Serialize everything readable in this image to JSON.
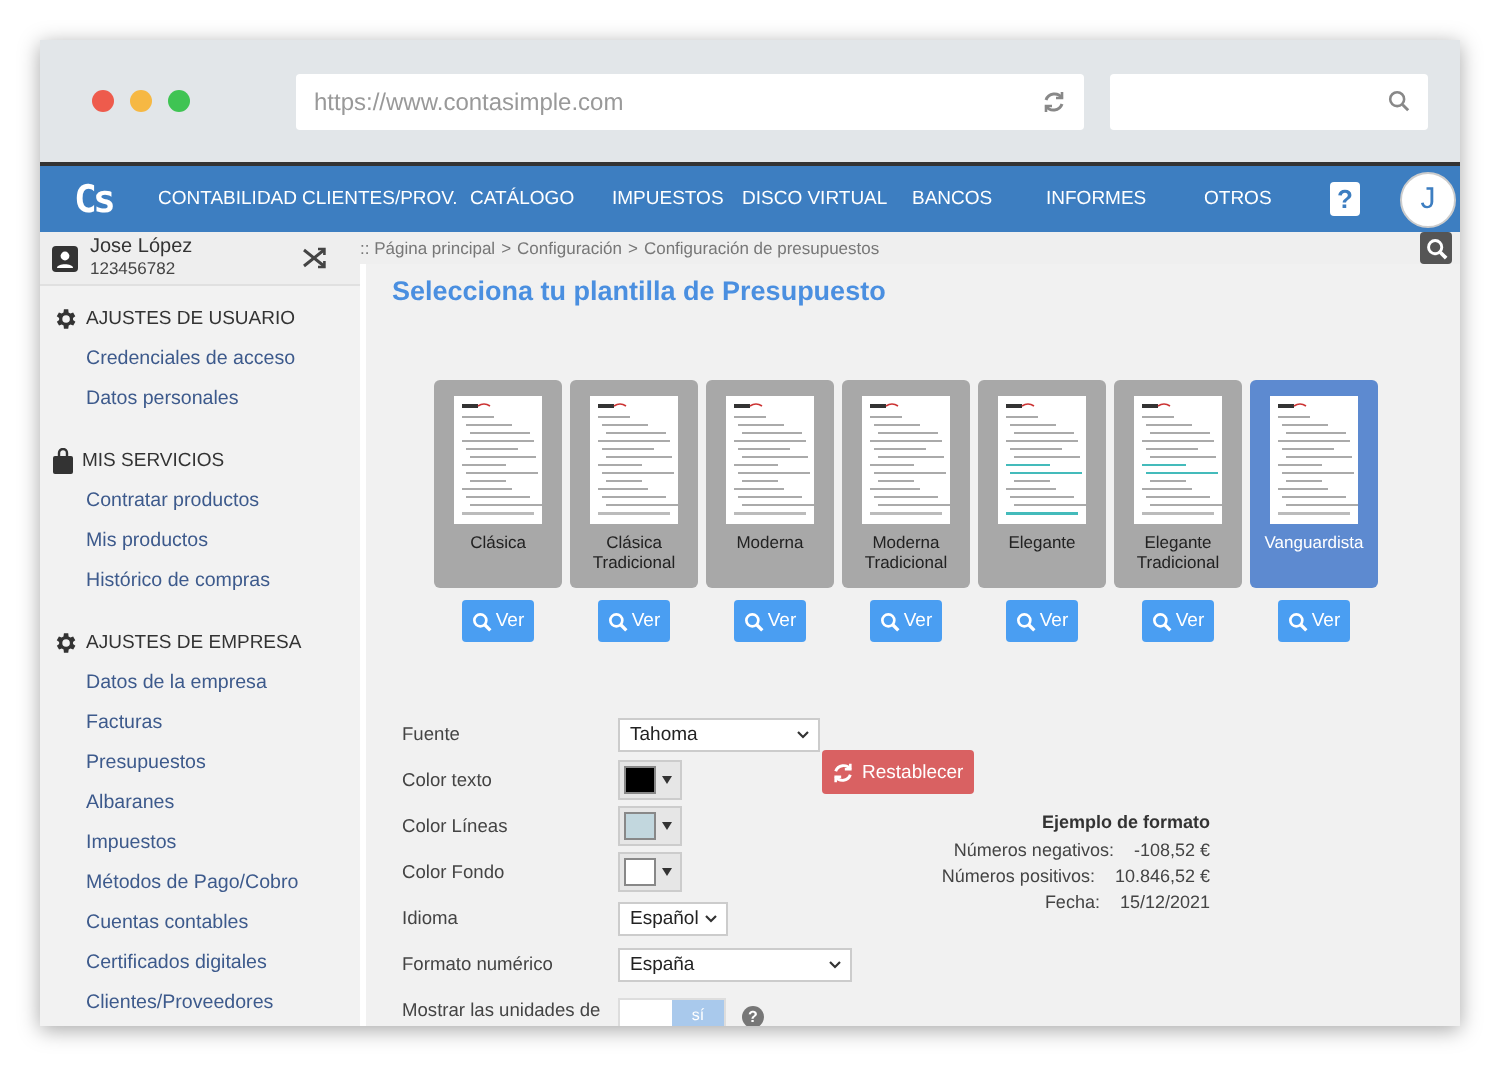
{
  "browser": {
    "url": "https://www.contasimple.com"
  },
  "nav": {
    "logo": "Cs",
    "items": [
      "CONTABILIDAD",
      "CLIENTES/PROV.",
      "CATÁLOGO",
      "IMPUESTOS",
      "DISCO VIRTUAL",
      "BANCOS",
      "INFORMES",
      "OTROS"
    ],
    "help": "?",
    "avatar": "J"
  },
  "user": {
    "name": "Jose López",
    "id": "123456782"
  },
  "breadcrumb": [
    ":: Página principal",
    ">",
    "Configuración",
    ">",
    "Configuración de presupuestos"
  ],
  "sidebar": {
    "sections": [
      {
        "kind": "gear",
        "title": "AJUSTES DE USUARIO",
        "items": [
          "Credenciales de acceso",
          "Datos personales"
        ]
      },
      {
        "kind": "bag",
        "title": "MIS SERVICIOS",
        "items": [
          "Contratar productos",
          "Mis productos",
          "Histórico de compras"
        ]
      },
      {
        "kind": "gear",
        "title": "AJUSTES DE EMPRESA",
        "items": [
          "Datos de la empresa",
          "Facturas",
          "Presupuestos",
          "Albaranes",
          "Impuestos",
          "Métodos de Pago/Cobro",
          "Cuentas contables",
          "Certificados digitales",
          "Clientes/Proveedores"
        ]
      }
    ]
  },
  "page": {
    "title": "Selecciona tu plantilla de Presupuesto"
  },
  "templates": [
    {
      "name": "Clásica",
      "selected": false,
      "button": "Ver"
    },
    {
      "name": "Clásica Tradicional",
      "selected": false,
      "button": "Ver"
    },
    {
      "name": "Moderna",
      "selected": false,
      "button": "Ver"
    },
    {
      "name": "Moderna Tradicional",
      "selected": false,
      "button": "Ver"
    },
    {
      "name": "Elegante",
      "selected": false,
      "button": "Ver"
    },
    {
      "name": "Elegante Tradicional",
      "selected": false,
      "button": "Ver"
    },
    {
      "name": "Vanguardista",
      "selected": true,
      "button": "Ver"
    }
  ],
  "form": [
    {
      "kind": "select",
      "label": "Fuente",
      "value": "Tahoma"
    },
    {
      "kind": "color",
      "label": "Color texto",
      "color": "#000000"
    },
    {
      "kind": "color",
      "label": "Color Líneas",
      "color": "#c2d7de"
    },
    {
      "kind": "color",
      "label": "Color Fondo",
      "color": "#ffffff"
    },
    {
      "kind": "select",
      "label": "Idioma",
      "value": "Español"
    },
    {
      "kind": "select",
      "label": "Formato numérico",
      "value": "España"
    },
    {
      "kind": "toggle",
      "label": "Mostrar las unidades de",
      "on": true,
      "on_label": "sí",
      "help": "?"
    }
  ],
  "reset_button": "Restablecer",
  "example": {
    "title": "Ejemplo de formato",
    "rows": [
      {
        "label": "Números negativos:",
        "value": "-108,52 €"
      },
      {
        "label": "Números positivos:",
        "value": "10.846,52 €"
      },
      {
        "label": "Fecha:",
        "value": "15/12/2021"
      }
    ]
  }
}
